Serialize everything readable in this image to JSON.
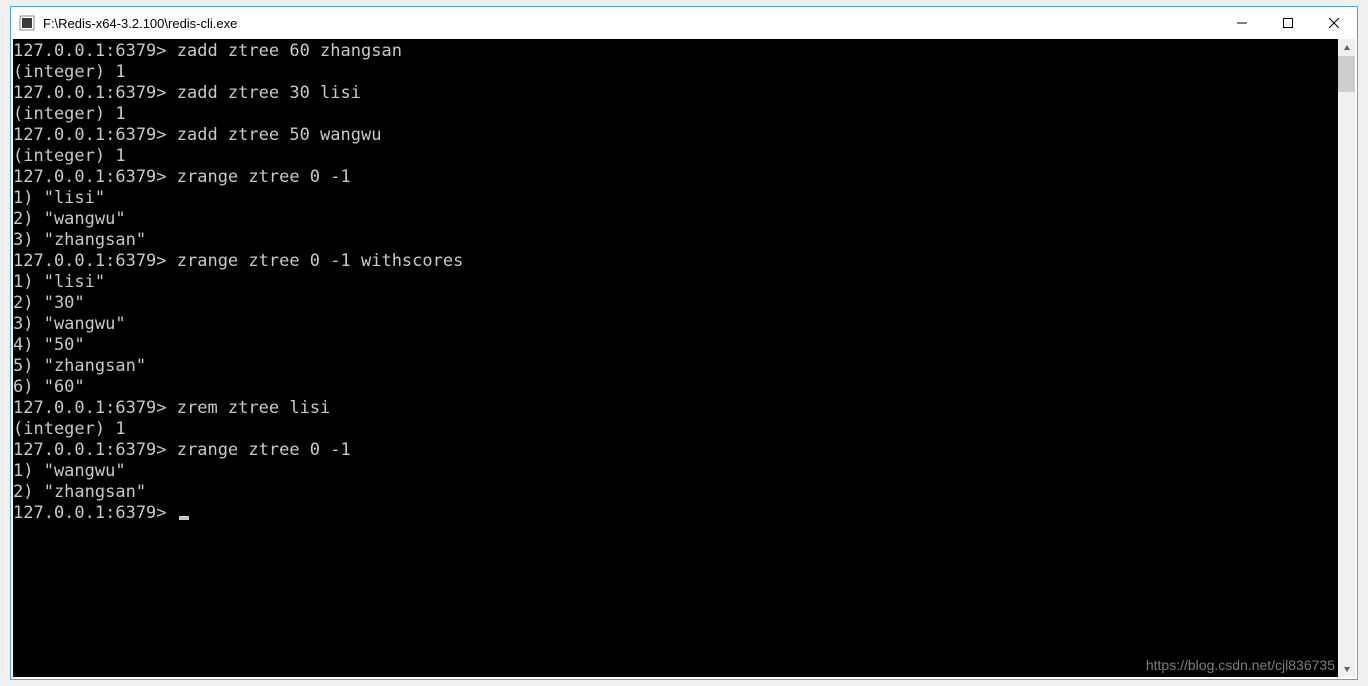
{
  "window": {
    "title": "F:\\Redis-x64-3.2.100\\redis-cli.exe"
  },
  "terminal": {
    "prompt": "127.0.0.1:6379>",
    "lines": [
      "127.0.0.1:6379> zadd ztree 60 zhangsan",
      "(integer) 1",
      "127.0.0.1:6379> zadd ztree 30 lisi",
      "(integer) 1",
      "127.0.0.1:6379> zadd ztree 50 wangwu",
      "(integer) 1",
      "127.0.0.1:6379> zrange ztree 0 -1",
      "1) \"lisi\"",
      "2) \"wangwu\"",
      "3) \"zhangsan\"",
      "127.0.0.1:6379> zrange ztree 0 -1 withscores",
      "1) \"lisi\"",
      "2) \"30\"",
      "3) \"wangwu\"",
      "4) \"50\"",
      "5) \"zhangsan\"",
      "6) \"60\"",
      "127.0.0.1:6379> zrem ztree lisi",
      "(integer) 1",
      "127.0.0.1:6379> zrange ztree 0 -1",
      "1) \"wangwu\"",
      "2) \"zhangsan\""
    ],
    "current_prompt": "127.0.0.1:6379> "
  },
  "watermark": "https://blog.csdn.net/cjl836735"
}
